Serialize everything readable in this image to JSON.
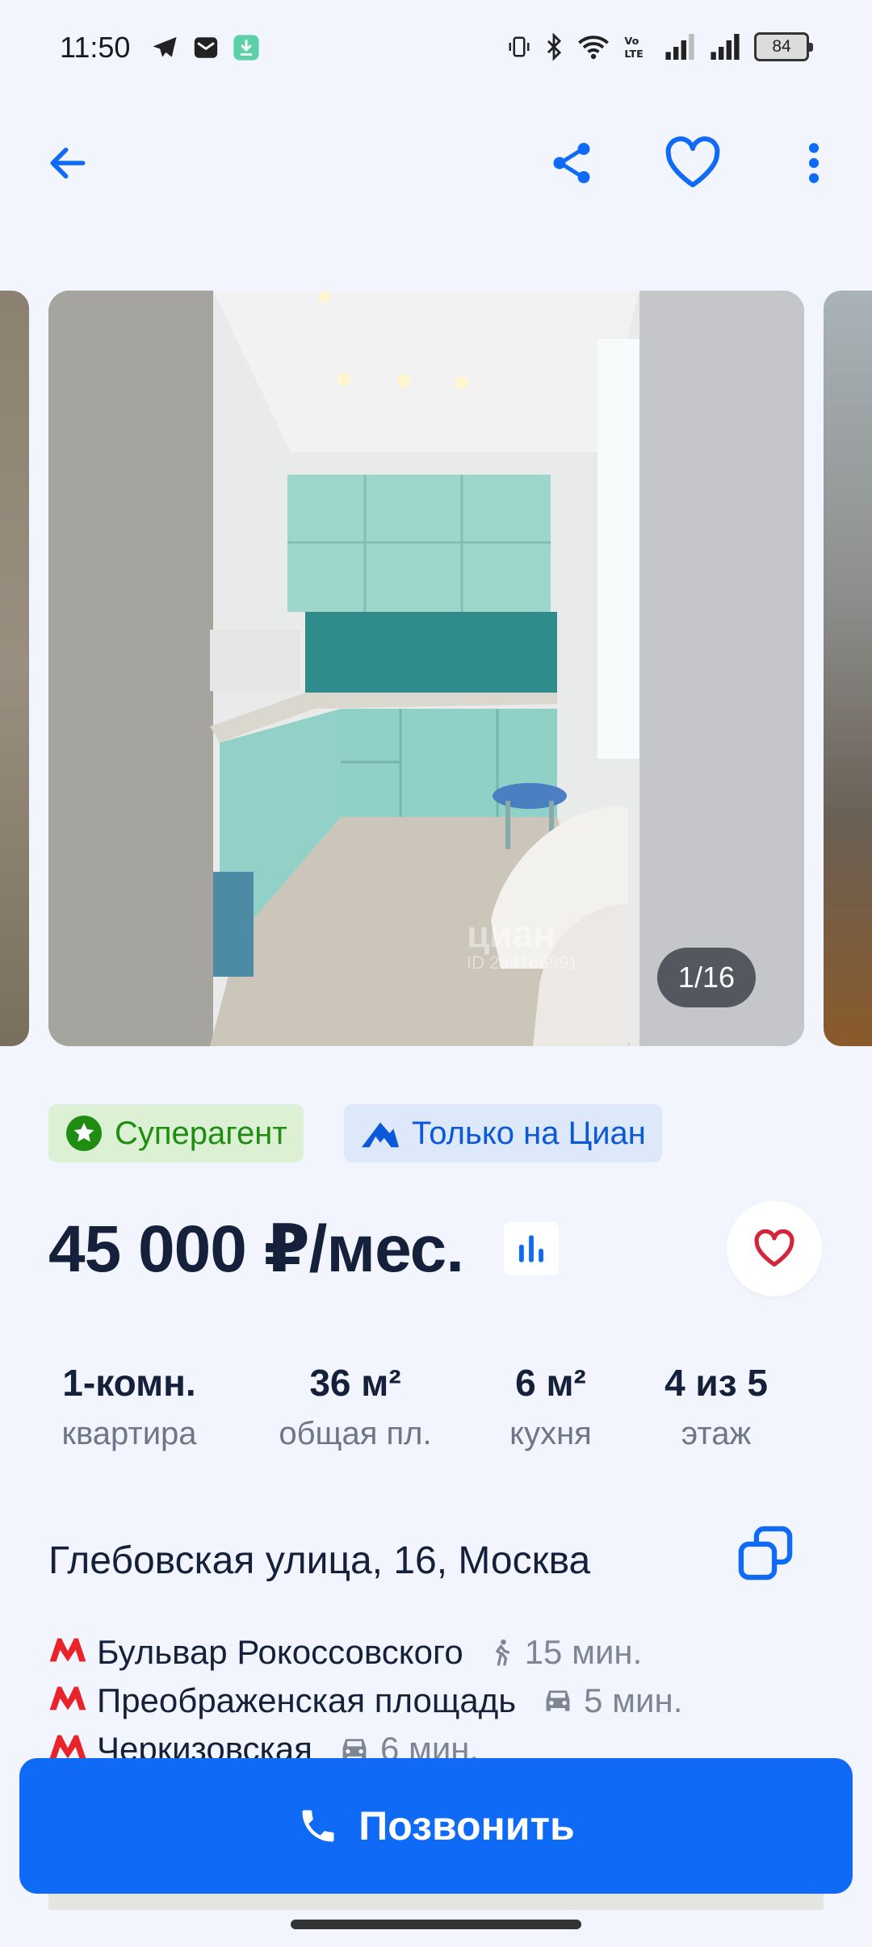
{
  "status_bar": {
    "time": "11:50",
    "battery": "84",
    "left_icons": [
      "telegram-icon",
      "mail-icon",
      "download-icon"
    ],
    "right_icons": [
      "vibrate-icon",
      "bluetooth-icon",
      "wifi-icon",
      "volte-icon",
      "signal-icon",
      "signal-icon"
    ]
  },
  "appbar": {
    "icons": [
      "back-arrow-icon",
      "share-icon",
      "heart-outline-icon",
      "more-vert-icon"
    ],
    "accent": "#0f6bf5"
  },
  "gallery": {
    "counter": "1/16",
    "watermark_brand": "циан",
    "watermark_id": "ID 284166991"
  },
  "badges": {
    "superagent": "Суперагент",
    "only_cian": "Только на Циан"
  },
  "price": {
    "text": "45 000 ₽/мес."
  },
  "stats": [
    {
      "value": "1-комн.",
      "label": "квартира"
    },
    {
      "value": "36 м²",
      "label": "общая пл."
    },
    {
      "value": "6 м²",
      "label": "кухня"
    },
    {
      "value": "4 из 5",
      "label": "этаж"
    }
  ],
  "address": "Глебовская улица, 16, Москва",
  "metro": [
    {
      "station": "Бульвар Рокоссовского",
      "mode": "walk-icon",
      "time": "15 мин."
    },
    {
      "station": "Преображенская площадь",
      "mode": "car-icon",
      "time": "5 мин."
    },
    {
      "station": "Черкизовская",
      "mode": "car-icon",
      "time": "6 мин."
    }
  ],
  "call_button": "Позвонить",
  "colors": {
    "metro_red": "#e8232a",
    "superagent_green": "#1f8c12",
    "favorite_red": "#d3263b"
  }
}
